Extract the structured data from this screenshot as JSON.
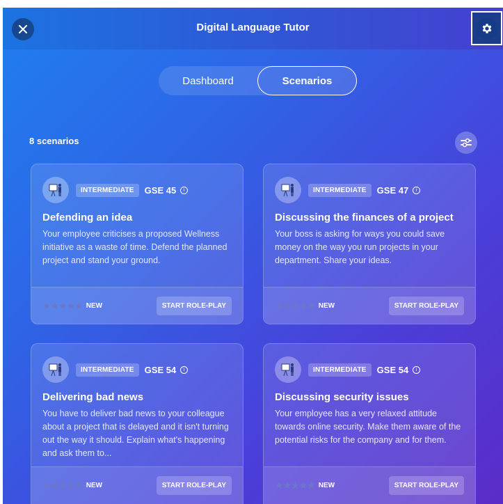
{
  "header": {
    "title": "Digital Language Tutor",
    "close_icon": "close-icon",
    "settings_icon": "gear-icon"
  },
  "tabs": [
    {
      "label": "Dashboard",
      "active": false
    },
    {
      "label": "Scenarios",
      "active": true
    }
  ],
  "scenarios_count": "8 scenarios",
  "filter_icon": "sliders-icon",
  "cards": [
    {
      "level": "INTERMEDIATE",
      "gse": "GSE 45",
      "title": "Defending an idea",
      "description": "Your employee criticises a proposed Wellness initiative as a waste of time. Defend the planned project and stand your ground.",
      "stars": "★★★★★",
      "badge": "NEW",
      "button": "START ROLE-PLAY"
    },
    {
      "level": "INTERMEDIATE",
      "gse": "GSE 47",
      "title": "Discussing the finances of a project",
      "description": "Your boss is asking for ways you could save money on the way you run projects in your department. Share your ideas.",
      "stars": "★★★★★",
      "badge": "NEW",
      "button": "START ROLE-PLAY"
    },
    {
      "level": "INTERMEDIATE",
      "gse": "GSE 54",
      "title": "Delivering bad news",
      "description": "You have to deliver bad news to your colleague about a project that is delayed and it isn't turning out the way it should. Explain what's happening and ask them to...",
      "stars": "★★★★★",
      "badge": "NEW",
      "button": "START ROLE-PLAY"
    },
    {
      "level": "INTERMEDIATE",
      "gse": "GSE 54",
      "title": "Discussing security issues",
      "description": "Your employee has a very relaxed attitude towards online security. Make them aware of the potential risks for the company and for them.",
      "stars": "★★★★★",
      "badge": "NEW",
      "button": "START ROLE-PLAY"
    }
  ]
}
